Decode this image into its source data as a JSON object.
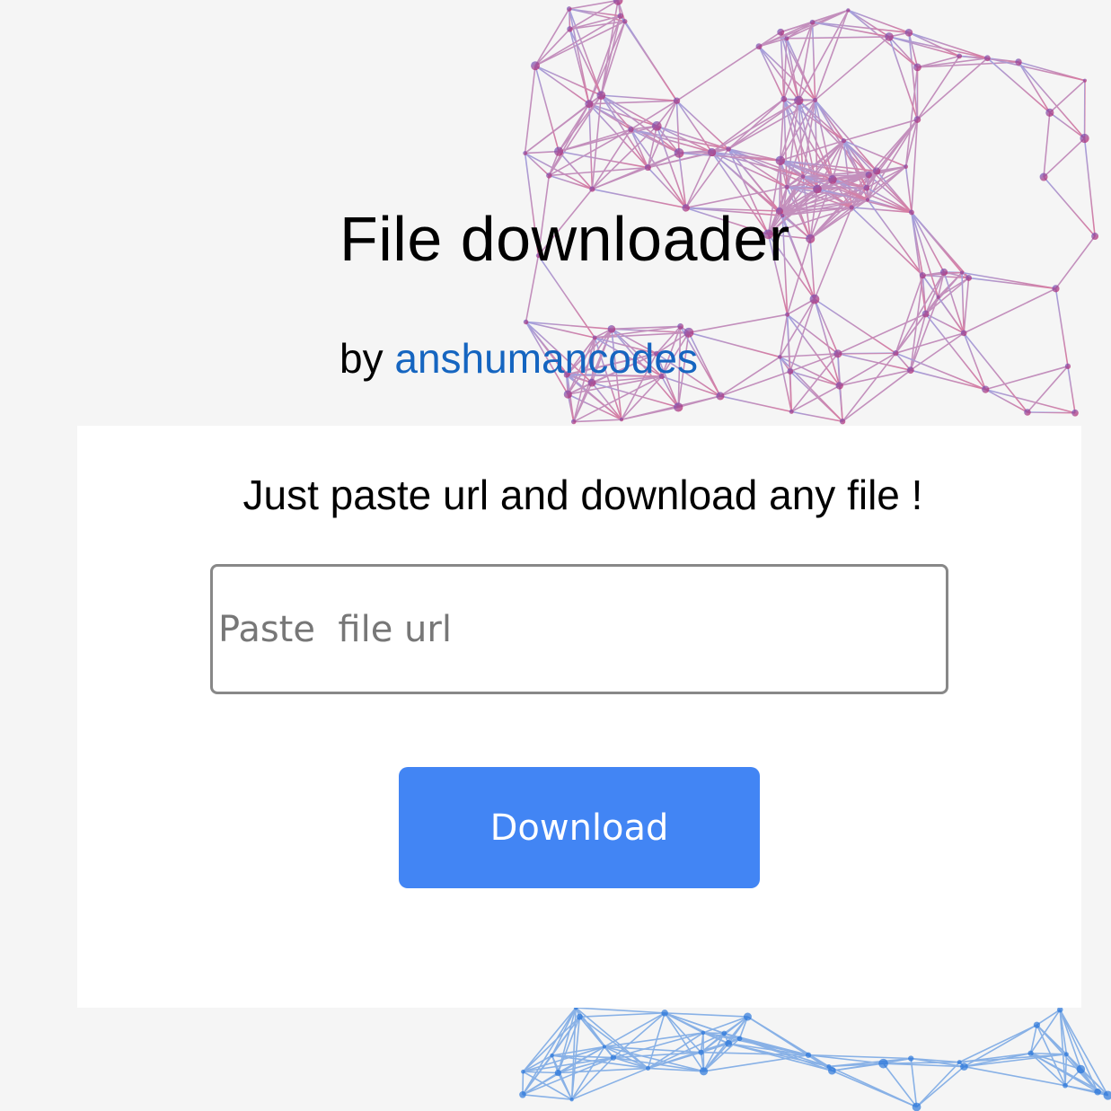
{
  "header": {
    "title": "File downloader",
    "byline_prefix": "by",
    "author_link": "anshumancodes"
  },
  "card": {
    "tagline": "Just paste url and download any file !",
    "url_input": {
      "value": "",
      "placeholder": "Paste  file url"
    },
    "download_label": "Download"
  },
  "colors": {
    "background": "#f5f5f5",
    "card": "#ffffff",
    "link": "#1565c0",
    "button": "#4285f4",
    "network_purple": "#6a5acd",
    "network_red": "#c2185b",
    "network_blue": "#1e6fd9"
  }
}
